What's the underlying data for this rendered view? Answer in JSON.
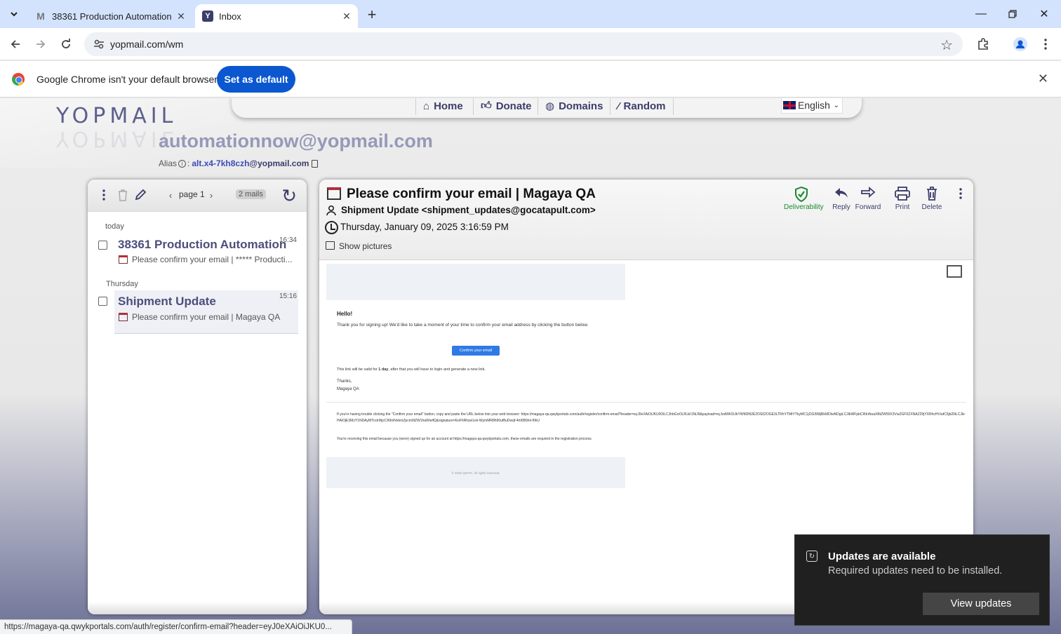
{
  "tabs": [
    {
      "title": "38361 Production Automation",
      "favicon": "M"
    },
    {
      "title": "Inbox",
      "favicon": "Y"
    }
  ],
  "omnibox": {
    "url": "yopmail.com/wm"
  },
  "infobar": {
    "message": "Google Chrome isn't your default browser",
    "button": "Set as default"
  },
  "site": {
    "logo": "YOPMAIL",
    "nav": [
      {
        "label": "Home",
        "icon": "home-icon"
      },
      {
        "label": "Donate",
        "icon": "thumbs-up-icon"
      },
      {
        "label": "Domains",
        "icon": "globe-icon"
      },
      {
        "label": "Random",
        "icon": "magic-wand-icon"
      }
    ],
    "language": "English",
    "mailbox": "automationnow@yopmail.com",
    "alias_label": "Alias",
    "alias_value": "alt.x4-7kh8czh",
    "alias_domain": "@yopmail.com"
  },
  "inbox": {
    "pager": "page 1",
    "count": "2 mails",
    "groups": [
      {
        "day": "today",
        "mails": [
          {
            "from": "38361 Production Automation",
            "time": "16:34",
            "subject": "Please confirm your email | ***** Producti..."
          }
        ]
      },
      {
        "day": "Thursday",
        "mails": [
          {
            "from": "Shipment Update",
            "time": "15:16",
            "subject": "Please confirm your email | Magaya QA"
          }
        ]
      }
    ]
  },
  "reader": {
    "subject": "Please confirm your email | Magaya QA",
    "from": "Shipment Update <shipment_updates@gocatapult.com>",
    "date": "Thursday, January 09, 2025 3:16:59 PM",
    "show_pictures": "Show pictures",
    "actions": {
      "deliverability": "Deliverability",
      "reply": "Reply",
      "forward": "Forward",
      "print": "Print",
      "delete": "Delete"
    },
    "body": {
      "hello": "Hello!",
      "intro": "Thank you for signing up! We'd like to take a moment of your time to confirm your email address by clicking the button below.",
      "button": "Confirm your email",
      "valid_pre": "This link will be valid for ",
      "valid_bold": "1 day",
      "valid_post": ", after that you will have to login and generate a new link.",
      "thanks": "Thanks,",
      "signature": "Magaya QA",
      "trouble": "If you're having trouble clicking the \"Confirm your email\" button, copy and paste the URL below into your web browser: https://magaya-qa.qwykportals.com/auth/register/confirm-email?header=eyJ0eXAiOiJKU0OiLCJhbGciOiJIUzI1NiJ9&payload=eyJzdWIiOiJkYWM3N2E2OS02OGE3LTRhYTMtYTkyMC1jOGI5MjRkMDIwNDgiLCJlbWFpbCI6InNoaXBtZW50X3VwZGF0ZXNAZ29jYXRhcHVsdC5jb20iLCJleHAiOjE3MzY1NDAyMTcsInNjcCI6ImNvbmZpcm0tZW1haWwifQ&signature=EoFhRhyw1ek-WymMR8h90uf8uDwqf-4nt6B9ml-f0kU",
      "receiving": "You're receiving this email because you (were) signed up for an account at https://magaya-qa.qwykportals.com, these emails are required in the registration process.",
      "footer": "© 2025 QWYK. All rights reserved."
    }
  },
  "statusbar": "https://magaya-qa.qwykportals.com/auth/register/confirm-email?header=eyJ0eXAiOiJKU0...",
  "toast": {
    "title": "Updates are available",
    "body": "Required updates need to be installed.",
    "button": "View updates"
  }
}
